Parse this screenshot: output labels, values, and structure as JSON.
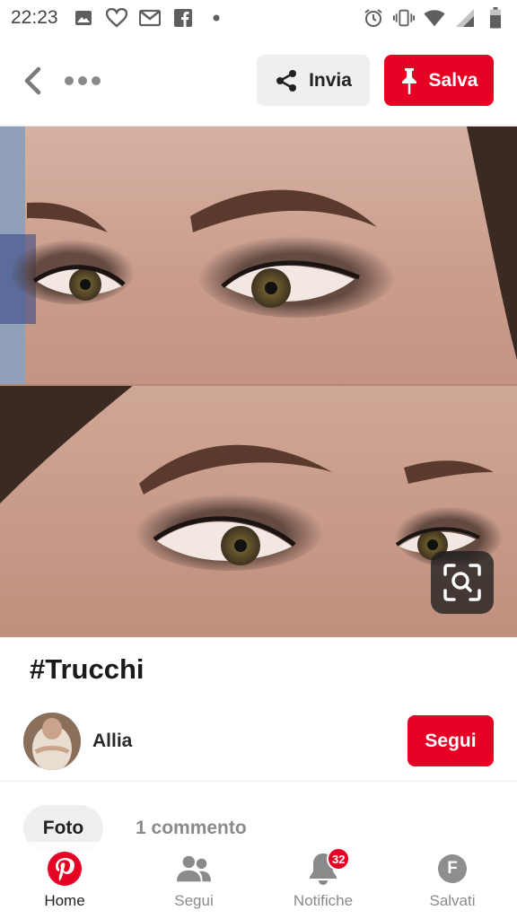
{
  "status_bar": {
    "time": "22:23",
    "left_icons": [
      "gallery-icon",
      "heart-outline-icon",
      "gmail-icon",
      "facebook-icon",
      "dot-icon"
    ],
    "right_icons": [
      "alarm-icon",
      "vibrate-icon",
      "wifi-icon",
      "signal-icon",
      "battery-icon"
    ]
  },
  "toolbar": {
    "share_label": "Invia",
    "save_label": "Salva"
  },
  "pin": {
    "title": "#Trucchi",
    "author_name": "Allia",
    "follow_label": "Segui"
  },
  "tabs": {
    "photo_label": "Foto",
    "comments_label": "1 commento"
  },
  "bottom_nav": {
    "items": [
      {
        "label": "Home",
        "active": true
      },
      {
        "label": "Segui"
      },
      {
        "label": "Notifiche",
        "badge": "32"
      },
      {
        "label": "Salvati",
        "avatar_letter": "F"
      }
    ]
  },
  "colors": {
    "brand_red": "#e60023",
    "inactive_gray": "#8a8a8a"
  }
}
